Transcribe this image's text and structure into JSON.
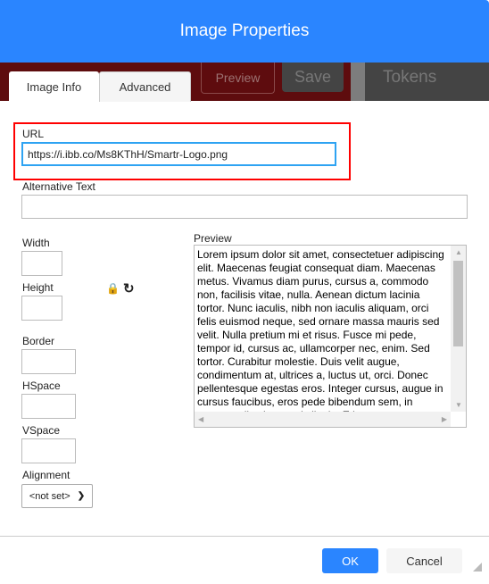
{
  "dialog": {
    "title": "Image Properties"
  },
  "background": {
    "preview": "Preview",
    "save": "Save",
    "tokens": "Tokens"
  },
  "tabs": [
    {
      "label": "Image Info",
      "active": true
    },
    {
      "label": "Advanced",
      "active": false
    }
  ],
  "url": {
    "label": "URL",
    "value": "https://i.ibb.co/Ms8KThH/Smartr-Logo.png"
  },
  "alt": {
    "label": "Alternative Text",
    "value": ""
  },
  "width": {
    "label": "Width",
    "value": ""
  },
  "height": {
    "label": "Height",
    "value": ""
  },
  "border": {
    "label": "Border",
    "value": ""
  },
  "hspace": {
    "label": "HSpace",
    "value": ""
  },
  "vspace": {
    "label": "VSpace",
    "value": ""
  },
  "alignment": {
    "label": "Alignment",
    "value": "<not set>"
  },
  "preview": {
    "label": "Preview",
    "text": "Lorem ipsum dolor sit amet, consectetuer adipiscing elit. Maecenas feugiat consequat diam. Maecenas metus. Vivamus diam purus, cursus a, commodo non, facilisis vitae, nulla. Aenean dictum lacinia tortor. Nunc iaculis, nibh non iaculis aliquam, orci felis euismod neque, sed ornare massa mauris sed velit. Nulla pretium mi et risus. Fusce mi pede, tempor id, cursus ac, ullamcorper nec, enim. Sed tortor. Curabitur molestie. Duis velit augue, condimentum at, ultrices a, luctus ut, orci. Donec pellentesque egestas eros. Integer cursus, augue in cursus faucibus, eros pede bibendum sem, in tempus tellus justo quis ligula. Etiam eget tortor. Vestibulum rutrum, est ut placerat elementum, lectus nisl aliquam velit."
  },
  "buttons": {
    "ok": "OK",
    "cancel": "Cancel"
  },
  "colors": {
    "accent": "#2a85ff",
    "highlight": "#ff0000",
    "focus": "#2ea3f2"
  }
}
